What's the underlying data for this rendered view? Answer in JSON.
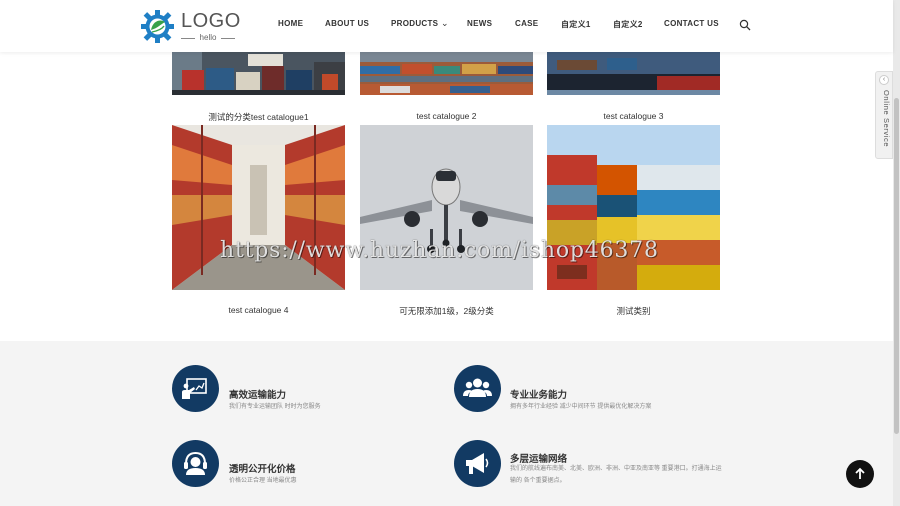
{
  "header": {
    "logo_text": "LOGO",
    "logo_sub": "hello",
    "nav": [
      {
        "label": "HOME"
      },
      {
        "label": "ABOUT US"
      },
      {
        "label": "PRODUCTS"
      },
      {
        "label": "NEWS"
      },
      {
        "label": "CASE"
      },
      {
        "label": "自定义1"
      },
      {
        "label": "自定义2"
      },
      {
        "label": "CONTACT US"
      }
    ],
    "products_arrow": "⌄"
  },
  "catalogue": {
    "row1": [
      {
        "caption": "测试的分类test catalogue1"
      },
      {
        "caption": "test catalogue 2"
      },
      {
        "caption": "test catalogue 3"
      }
    ],
    "row2": [
      {
        "caption": "test catalogue 4"
      },
      {
        "caption": "可无限添加1级，2级分类"
      },
      {
        "caption": "测试类别"
      }
    ]
  },
  "watermark": "https://www.huzhan.com/ishop46378",
  "features": [
    {
      "title": "高效运输能力",
      "desc": "我们有专业运输团队 时时为您服务"
    },
    {
      "title": "专业业务能力",
      "desc": "拥有多年行业经验 减少中间环节 提供最优化解决方案"
    },
    {
      "title": "透明公开化价格",
      "desc": "价格公正合理 当地最优惠"
    },
    {
      "title": "多层运输网络",
      "desc": "我们的航线遍布南美、北美、欧洲、非洲、中亚及南亚等 重要港口。打通海上运输的 各个重要据点。"
    }
  ],
  "side": {
    "online_service": "Online Service",
    "collapse_arrow": "‹"
  },
  "colors": {
    "feature_icon_bg": "#123a63",
    "logo_blue": "#1f7fc5",
    "logo_green": "#38a24a"
  }
}
